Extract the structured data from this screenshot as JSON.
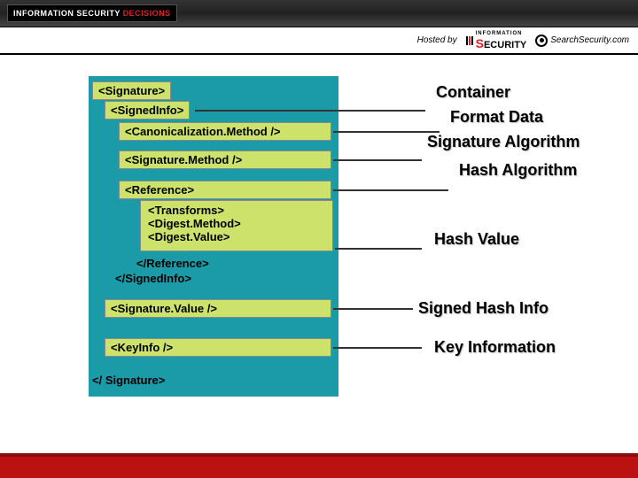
{
  "header": {
    "logo_prefix": "INFORMATION SECURITY ",
    "logo_suffix": "DECISIONS",
    "hosted_by": "Hosted by",
    "security_small": "INFORMATION",
    "security_word": "ECURITY",
    "search_text": "SearchSecurity.com"
  },
  "xml": {
    "signature_open": "<Signature>",
    "signedinfo_open": "<SignedInfo>",
    "canon": "<Canonicalization.Method />",
    "sigmethod": "<Signature.Method />",
    "reference_open": "<Reference>",
    "transforms": "<Transforms>",
    "digestmethod": "<Digest.Method>",
    "digestvalue": "<Digest.Value>",
    "reference_close": "</Reference>",
    "signedinfo_close": "</SignedInfo>",
    "sigvalue": "<Signature.Value />",
    "keyinfo": "<KeyInfo />",
    "signature_close": "</ Signature>"
  },
  "labels": {
    "container": "Container",
    "format_data": "Format Data",
    "sig_algo": "Signature Algorithm",
    "hash_algo": "Hash Algorithm",
    "hash_value": "Hash Value",
    "signed_hash": "Signed Hash Info",
    "key_info": "Key Information"
  }
}
